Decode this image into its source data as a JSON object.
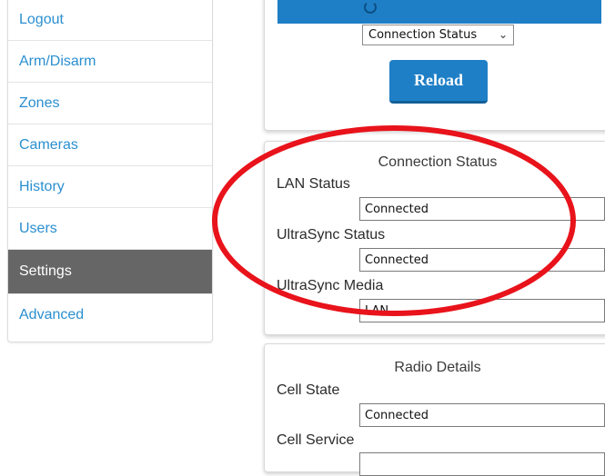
{
  "sidebar": {
    "items": [
      {
        "label": "Logout",
        "active": false
      },
      {
        "label": "Arm/Disarm",
        "active": false
      },
      {
        "label": "Zones",
        "active": false
      },
      {
        "label": "Cameras",
        "active": false
      },
      {
        "label": "History",
        "active": false
      },
      {
        "label": "Users",
        "active": false
      },
      {
        "label": "Settings",
        "active": true
      },
      {
        "label": "Advanced",
        "active": false
      }
    ]
  },
  "top_panel": {
    "select_value": "Connection Status",
    "reload_label": "Reload"
  },
  "connection_status": {
    "title": "Connection Status",
    "fields": [
      {
        "label": "LAN Status",
        "value": "Connected"
      },
      {
        "label": "UltraSync Status",
        "value": "Connected"
      },
      {
        "label": "UltraSync Media",
        "value": "LAN"
      }
    ]
  },
  "radio_details": {
    "title": "Radio Details",
    "fields": [
      {
        "label": "Cell State",
        "value": "Connected"
      },
      {
        "label": "Cell Service",
        "value": ""
      }
    ]
  },
  "colors": {
    "accent": "#1f7fc6",
    "link": "#2a8fd0",
    "active_nav": "#666666",
    "annotation": "#e8131b"
  },
  "icons": {
    "select_chevron": "chevron-down-icon"
  }
}
